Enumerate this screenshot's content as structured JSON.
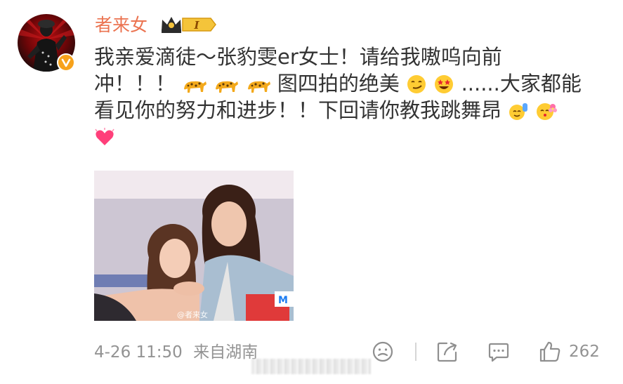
{
  "post": {
    "username": "者来女",
    "badge_label": "I",
    "text_lines": [
      "我亲爱滴徒～张豹雯er女士！请给我嗷呜向前",
      "冲！！！",
      "图四拍的绝美",
      "......大家都能",
      "看见你的努力和进步！！下回请你教我跳舞昂"
    ],
    "photo_watermark": "@者来女",
    "photo_logo": "M",
    "timestamp": "4-26 11:50",
    "source": "来自湖南",
    "likes": "262"
  },
  "colors": {
    "username": "#eb7350",
    "text": "#333333",
    "meta": "#939393",
    "verified": "#f7a21b"
  },
  "icons": {
    "verified": "verified-v-icon",
    "badge": "crown-level-badge-icon",
    "tiger_emoji": "leopard-emoji",
    "smirk_emoji": "smirk-emoji",
    "starstruck_emoji": "star-struck-emoji",
    "wave_emoji": "wave-emoji",
    "flower_emoji": "flower-emoji",
    "heart_emoji": "heart-emoji",
    "react": "smiley-react-icon",
    "share": "share-icon",
    "comment": "comment-icon",
    "like": "thumbs-up-icon"
  }
}
